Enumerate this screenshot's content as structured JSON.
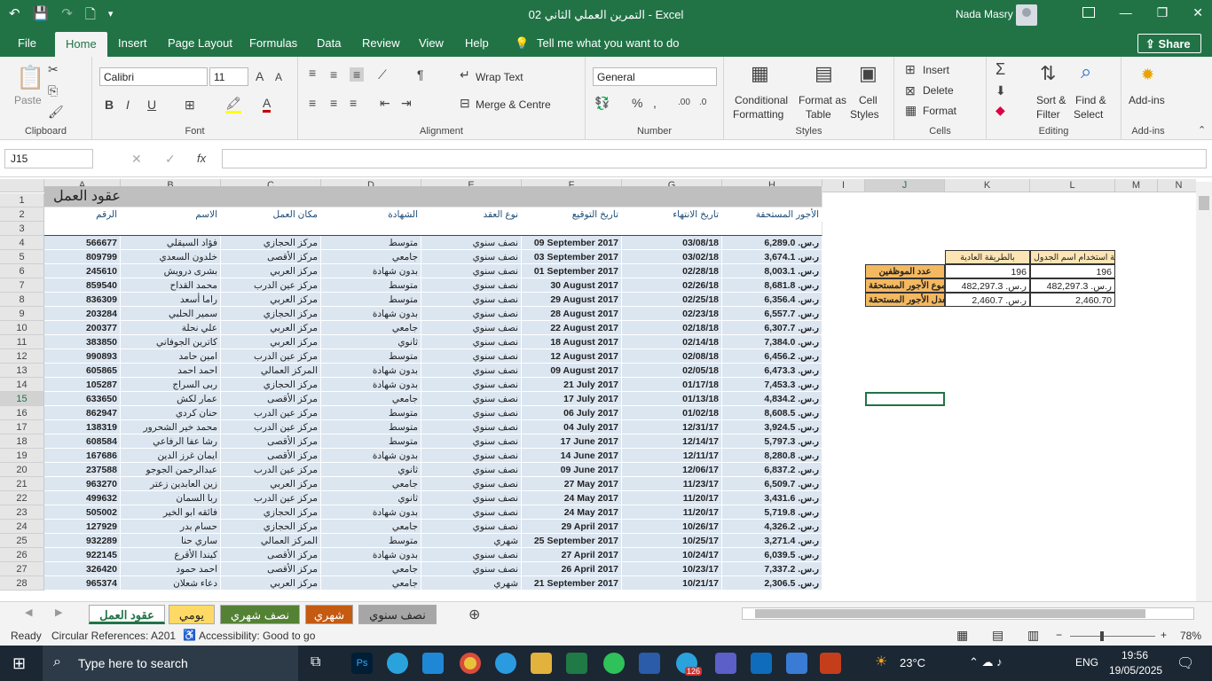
{
  "window": {
    "title": "02 التمرين العملي الثاني  -  Excel",
    "user": "Nada Masry",
    "minimize": "—",
    "restore": "❐",
    "close": "✕",
    "qat": [
      "↶",
      "💾",
      "↷",
      "🗋",
      "▾"
    ]
  },
  "tabs": [
    "File",
    "Home",
    "Insert",
    "Page Layout",
    "Formulas",
    "Data",
    "Review",
    "View",
    "Help"
  ],
  "tell_me": "Tell me what you want to do",
  "share": "Share",
  "ribbon": {
    "clipboard": {
      "label": "Clipboard",
      "paste": "Paste"
    },
    "font": {
      "label": "Font",
      "name": "Calibri",
      "size": "11"
    },
    "alignment": {
      "label": "Alignment",
      "wrap": "Wrap Text",
      "merge": "Merge & Centre"
    },
    "number": {
      "label": "Number",
      "format": "General"
    },
    "styles": {
      "label": "Styles",
      "cond1": "Conditional",
      "cond2": "Formatting",
      "fat1": "Format as",
      "fat2": "Table",
      "cs1": "Cell",
      "cs2": "Styles"
    },
    "cells": {
      "label": "Cells",
      "insert": "Insert",
      "delete": "Delete",
      "format": "Format"
    },
    "editing": {
      "label": "Editing",
      "sort1": "Sort &",
      "sort2": "Filter",
      "find1": "Find &",
      "find2": "Select"
    },
    "addins": {
      "label": "Add-ins",
      "btn": "Add-ins"
    }
  },
  "name_box": "J15",
  "fx": "fx",
  "columns": [
    "A",
    "B",
    "C",
    "D",
    "E",
    "F",
    "G",
    "H",
    "I",
    "J",
    "K",
    "L",
    "M",
    "N"
  ],
  "rows": [
    "1",
    "2",
    "3",
    "4",
    "5",
    "6",
    "7",
    "8",
    "9",
    "10",
    "11",
    "12",
    "13",
    "14",
    "15",
    "16",
    "17",
    "18",
    "19",
    "20",
    "21",
    "22",
    "23",
    "24",
    "25",
    "26",
    "27",
    "28"
  ],
  "sheet_title": "عقود العمل",
  "headers": [
    "الرقم",
    "الاسم",
    "مكان العمل",
    "الشهادة",
    "نوع العقد",
    "تاريخ التوقيع",
    "تاريخ الانتهاء",
    "الأجور المستحقة"
  ],
  "data": [
    [
      "566677",
      "فؤاد السيقلي",
      "مركز الحجازي",
      "متوسط",
      "نصف سنوي",
      "09 September 2017",
      "03/08/18",
      "ر.س. 6,289.0"
    ],
    [
      "809799",
      "خلدون السعدي",
      "مركز الأقصى",
      "جامعي",
      "نصف سنوي",
      "03 September 2017",
      "03/02/18",
      "ر.س. 3,674.1"
    ],
    [
      "245610",
      "بشرى درويش",
      "مركز العربي",
      "بدون شهادة",
      "نصف سنوي",
      "01 September 2017",
      "02/28/18",
      "ر.س. 8,003.1"
    ],
    [
      "859540",
      "محمد القداح",
      "مركز عين الدرب",
      "متوسط",
      "نصف سنوي",
      "30 August 2017",
      "02/26/18",
      "ر.س. 8,681.8"
    ],
    [
      "836309",
      "راما أسعد",
      "مركز العربي",
      "متوسط",
      "نصف سنوي",
      "29 August 2017",
      "02/25/18",
      "ر.س. 6,356.4"
    ],
    [
      "203284",
      "سمير الحلبي",
      "مركز الحجازي",
      "بدون شهادة",
      "نصف سنوي",
      "28 August 2017",
      "02/23/18",
      "ر.س. 6,557.7"
    ],
    [
      "200377",
      "علي نحلة",
      "مركز العربي",
      "جامعي",
      "نصف سنوي",
      "22 August 2017",
      "02/18/18",
      "ر.س. 6,307.7"
    ],
    [
      "383850",
      "كاترين الجوفاني",
      "مركز العربي",
      "ثانوي",
      "نصف سنوي",
      "18 August 2017",
      "02/14/18",
      "ر.س. 7,384.0"
    ],
    [
      "990893",
      "امين حامد",
      "مركز عين الدرب",
      "متوسط",
      "نصف سنوي",
      "12 August 2017",
      "02/08/18",
      "ر.س. 6,456.2"
    ],
    [
      "605865",
      "احمد احمد",
      "المركز العمالي",
      "بدون شهادة",
      "نصف سنوي",
      "09 August 2017",
      "02/05/18",
      "ر.س. 6,473.3"
    ],
    [
      "105287",
      "ربى السراج",
      "مركز الحجازي",
      "بدون شهادة",
      "نصف سنوي",
      "21 July 2017",
      "01/17/18",
      "ر.س. 7,453.3"
    ],
    [
      "633650",
      "عمار لكش",
      "مركز الأقصى",
      "جامعي",
      "نصف سنوي",
      "17 July 2017",
      "01/13/18",
      "ر.س. 4,834.2"
    ],
    [
      "862947",
      "حنان كردي",
      "مركز عين الدرب",
      "متوسط",
      "نصف سنوي",
      "06 July 2017",
      "01/02/18",
      "ر.س. 8,608.5"
    ],
    [
      "138319",
      "محمد خير الشحرور",
      "مركز عين الدرب",
      "متوسط",
      "نصف سنوي",
      "04 July 2017",
      "12/31/17",
      "ر.س. 3,924.5"
    ],
    [
      "608584",
      "رشا عفا الرفاعي",
      "مركز الأقصى",
      "متوسط",
      "نصف سنوي",
      "17 June 2017",
      "12/14/17",
      "ر.س. 5,797.3"
    ],
    [
      "167686",
      "ايمان غرز الدين",
      "مركز الأقصى",
      "بدون شهادة",
      "نصف سنوي",
      "14 June 2017",
      "12/11/17",
      "ر.س. 8,280.8"
    ],
    [
      "237588",
      "عبدالرحمن الجوجو",
      "مركز عين الدرب",
      "ثانوي",
      "نصف سنوي",
      "09 June 2017",
      "12/06/17",
      "ر.س. 6,837.2"
    ],
    [
      "963270",
      "زين العابدين زعتر",
      "مركز العربي",
      "جامعي",
      "نصف سنوي",
      "27 May 2017",
      "11/23/17",
      "ر.س. 6,509.7"
    ],
    [
      "499632",
      "ربا السمان",
      "مركز عين الدرب",
      "ثانوي",
      "نصف سنوي",
      "24 May 2017",
      "11/20/17",
      "ر.س. 3,431.6"
    ],
    [
      "505002",
      "فائقه ابو الخير",
      "مركز الحجازي",
      "بدون شهادة",
      "نصف سنوي",
      "24 May 2017",
      "11/20/17",
      "ر.س. 5,719.8"
    ],
    [
      "127929",
      "حسام بدر",
      "مركز الحجازي",
      "جامعي",
      "نصف سنوي",
      "29 April 2017",
      "10/26/17",
      "ر.س. 4,326.2"
    ],
    [
      "932289",
      "ساري حنا",
      "المركز العمالي",
      "متوسط",
      "شهري",
      "25 September 2017",
      "10/25/17",
      "ر.س. 3,271.4"
    ],
    [
      "922145",
      "كيندا الأقرع",
      "مركز الأقصى",
      "بدون شهادة",
      "نصف سنوي",
      "27 April 2017",
      "10/24/17",
      "ر.س. 6,039.5"
    ],
    [
      "326420",
      "احمد حمود",
      "مركز الأقصى",
      "جامعي",
      "نصف سنوي",
      "26 April 2017",
      "10/23/17",
      "ر.س. 7,337.2"
    ],
    [
      "965374",
      "دعاء شعلان",
      "مركز العربي",
      "جامعي",
      "شهري",
      "21 September 2017",
      "10/21/17",
      "ر.س. 2,306.5"
    ]
  ],
  "summary": {
    "hdr_k": "بالطريقة العادية",
    "hdr_l": "بطريقة استخدام اسم الجدول",
    "lbl_count": "عدد الموظفين",
    "lbl_sum": "مجموع الأجور المستحقة",
    "lbl_avg": "معدل الأجور المستحقة",
    "k_count": "196",
    "l_count": "196",
    "k_sum": "ر.س. 482,297.3",
    "l_sum": "ر.س. 482,297.3",
    "k_avg": "ر.س. 2,460.7",
    "l_avg": "2,460.70"
  },
  "sheets": [
    {
      "name": "عقود العمل",
      "color": "#ffffff"
    },
    {
      "name": "يومي",
      "color": "#ffd966"
    },
    {
      "name": "نصف شهري",
      "color": "#548235"
    },
    {
      "name": "شهري",
      "color": "#c55a11"
    },
    {
      "name": "نصف سنوي",
      "color": "#a6a6a6"
    }
  ],
  "status": {
    "ready": "Ready",
    "circular": "Circular References: A201",
    "access": "Accessibility: Good to go",
    "zoom": "78%"
  },
  "taskbar": {
    "search": "Type here to search",
    "temp": "23°C",
    "lang": "ENG",
    "time": "19:56",
    "date": "19/05/2025",
    "badge": "126"
  }
}
